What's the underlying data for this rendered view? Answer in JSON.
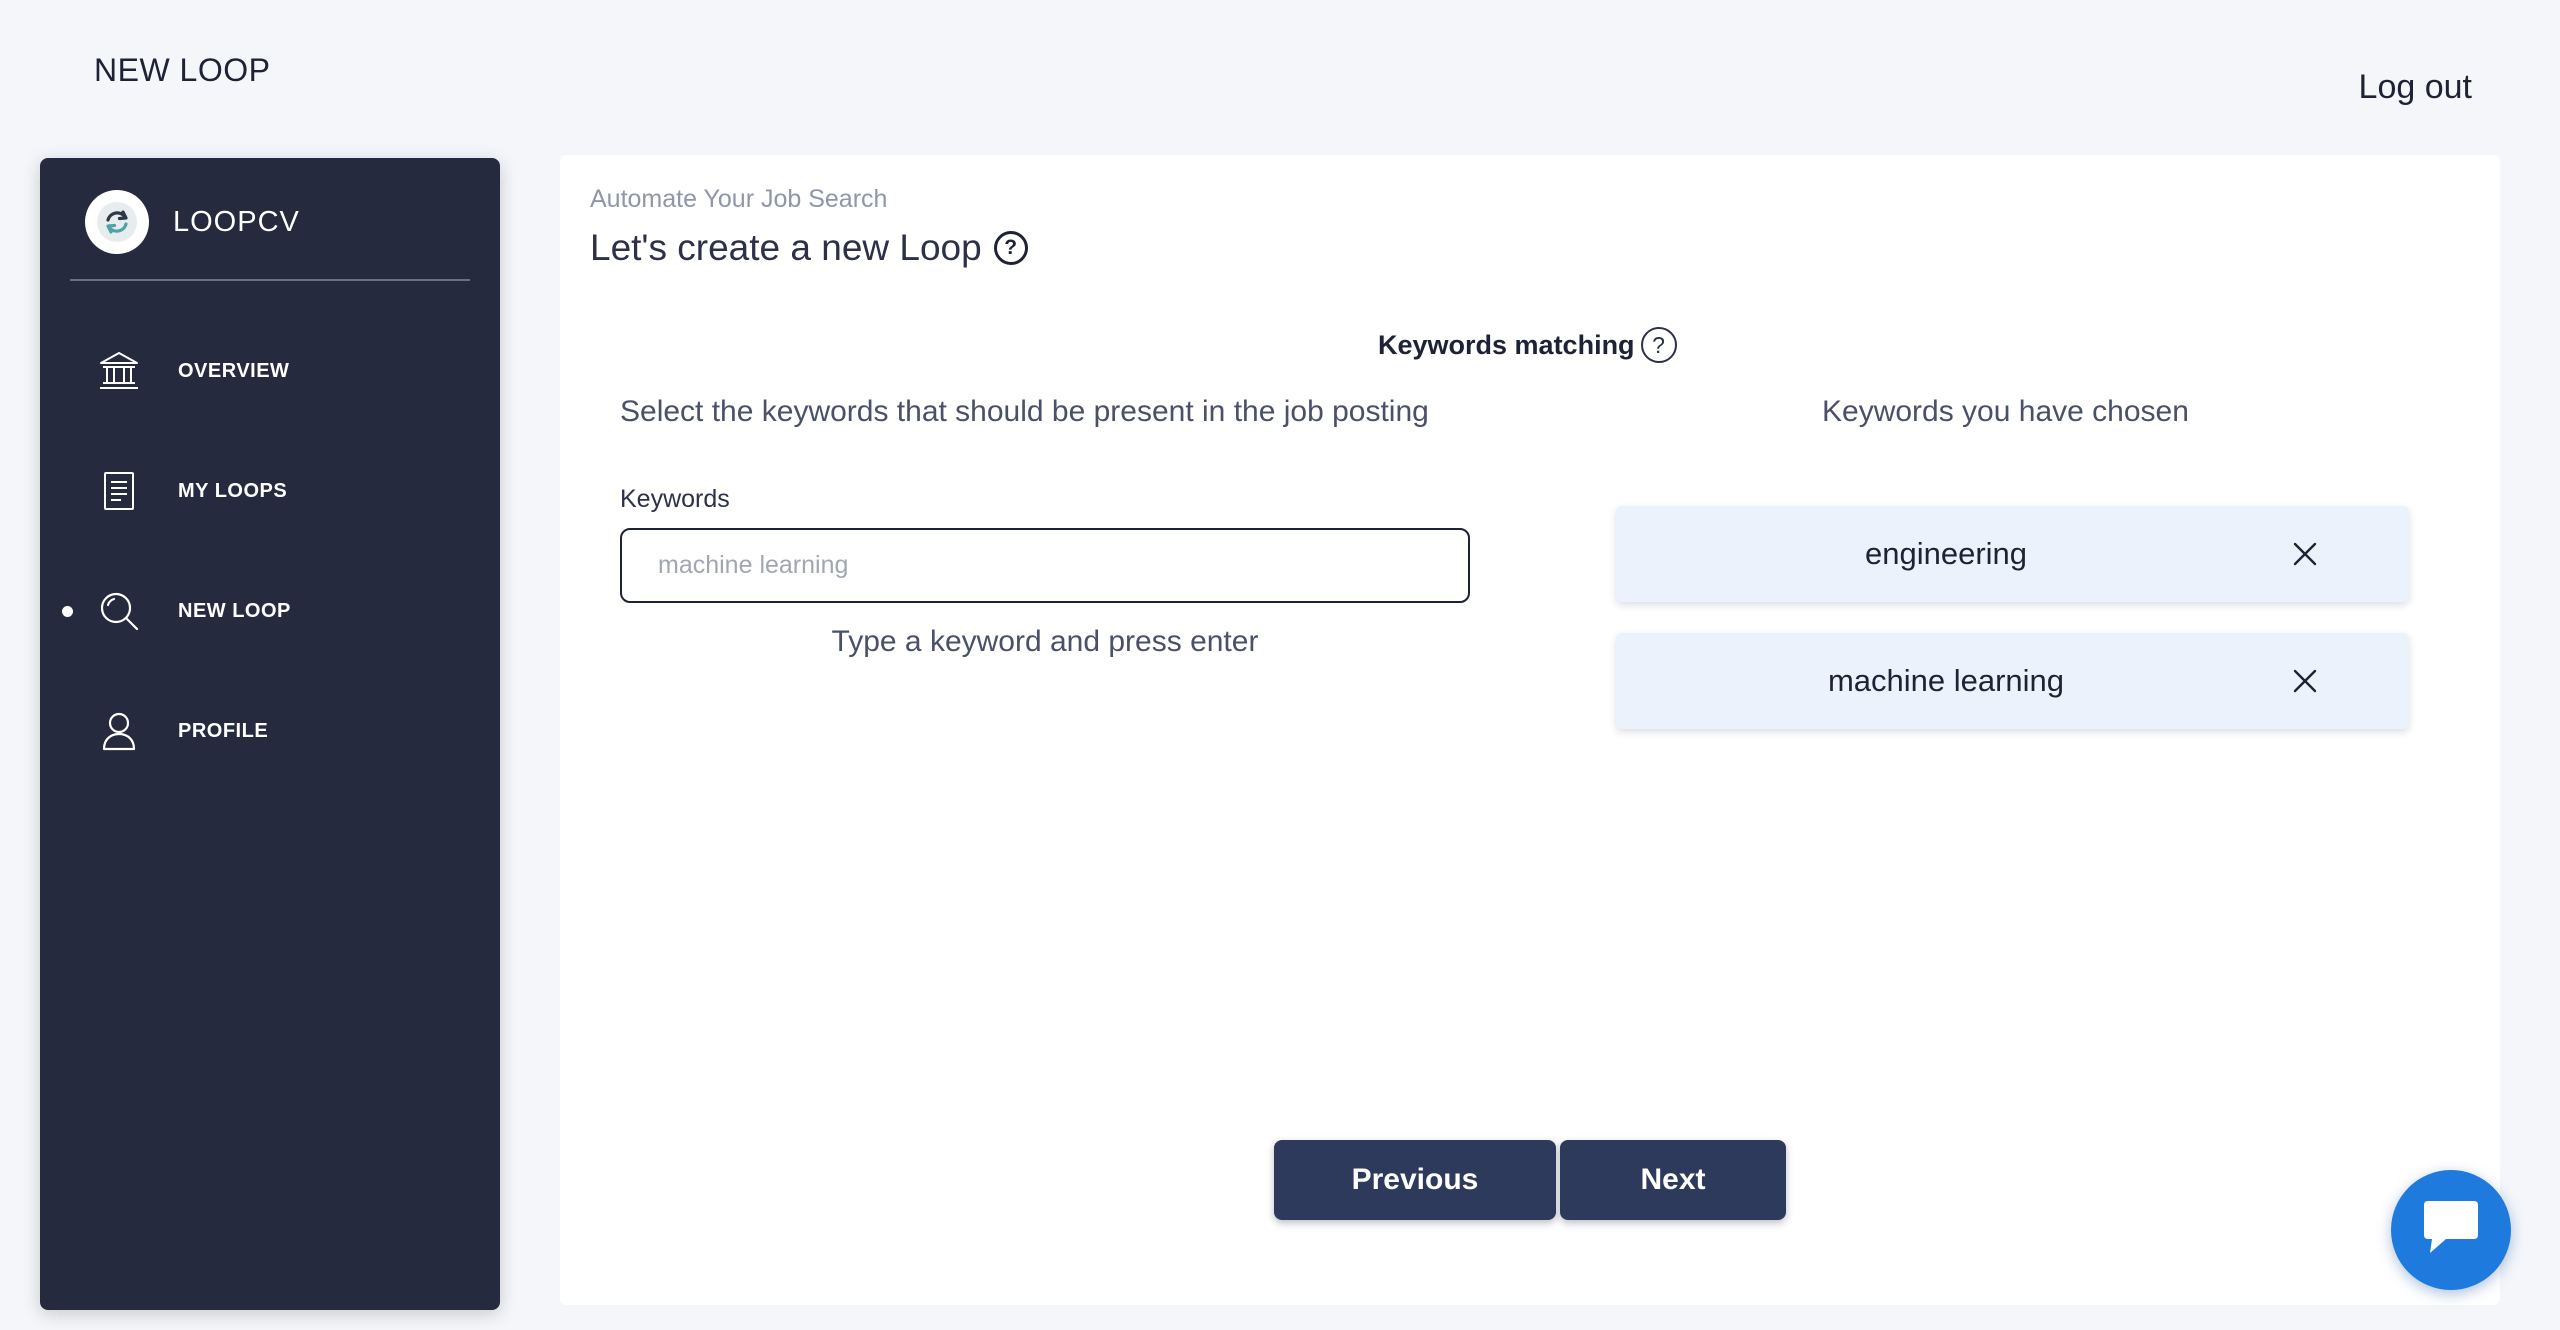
{
  "header": {
    "page_title": "NEW LOOP",
    "logout_label": "Log out"
  },
  "sidebar": {
    "brand": "LOOPCV",
    "items": [
      {
        "label": "OVERVIEW",
        "icon": "bank-icon",
        "active": false
      },
      {
        "label": "MY LOOPS",
        "icon": "document-list-icon",
        "active": false
      },
      {
        "label": "NEW LOOP",
        "icon": "search-icon",
        "active": true
      },
      {
        "label": "PROFILE",
        "icon": "user-icon",
        "active": false
      }
    ]
  },
  "main": {
    "eyebrow": "Automate Your Job Search",
    "title": "Let's create a new Loop",
    "help_glyph": "?",
    "section_title": "Keywords matching",
    "left_heading": "Select the keywords that should be present in the job posting",
    "right_heading": "Keywords you have chosen",
    "field_label": "Keywords",
    "input_placeholder": "machine learning",
    "input_value": "",
    "hint": "Type a keyword and press enter",
    "chosen_keywords": [
      "engineering",
      "machine learning"
    ],
    "previous_label": "Previous",
    "next_label": "Next"
  },
  "colors": {
    "sidebar_bg": "#252a3e",
    "button_bg": "#2e3a5c",
    "chip_bg": "#ebf2fb",
    "chat_fab": "#1e7bdd",
    "page_bg": "#f4f6fa"
  }
}
